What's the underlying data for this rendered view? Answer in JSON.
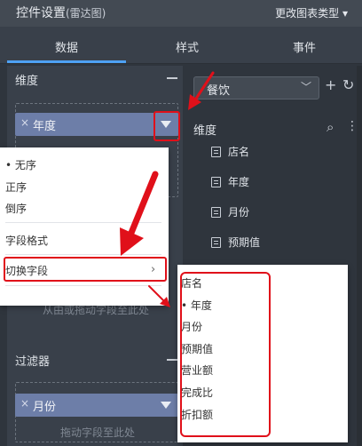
{
  "header": {
    "title": "控件设置",
    "subtitle": "(雷达图)",
    "change_chart_type": "更改图表类型 ▾"
  },
  "tabs": [
    {
      "label": "数据",
      "active": true
    },
    {
      "label": "样式",
      "active": false
    },
    {
      "label": "事件",
      "active": false
    }
  ],
  "left": {
    "dimension_label": "维度",
    "dimension_field": "年度",
    "pill_x": "×",
    "drop_hint_1": "从由或拖动字段至此处",
    "filter_label": "过滤器",
    "filter_field": "月份",
    "drop_hint_2": "拖动字段至此处"
  },
  "menu": {
    "items": [
      "• 无序",
      "正序",
      "倒序"
    ],
    "field_format": "字段格式",
    "switch_field": "切换字段",
    "chevron": "›"
  },
  "right": {
    "dataset": "餐饮",
    "dataset_chevron": "﹀",
    "plus": "+",
    "refresh": "↻",
    "dimension_label": "维度",
    "search": "⌕",
    "more": "⋮",
    "fields": [
      "店名",
      "年度",
      "月份",
      "预期值"
    ]
  },
  "submenu": {
    "items": [
      "店名",
      "• 年度",
      "月份",
      "预期值",
      "营业额",
      "完成比",
      "折扣额"
    ]
  },
  "colors": {
    "accent": "#4ea1f3",
    "highlight": "#e0101a",
    "pill": "#6d7ea8"
  }
}
